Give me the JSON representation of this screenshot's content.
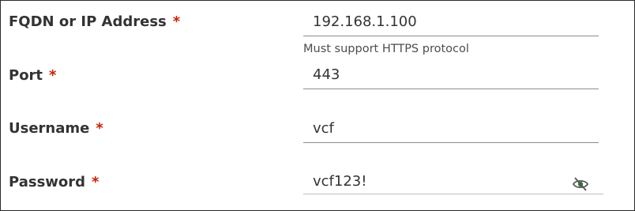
{
  "form": {
    "required_marker": "*",
    "fields": [
      {
        "label": "FQDN or IP Address",
        "value": "192.168.1.100",
        "hint": "Must support HTTPS protocol"
      },
      {
        "label": "Port",
        "value": "443"
      },
      {
        "label": "Username",
        "value": "vcf"
      },
      {
        "label": "Password",
        "value": "vcf123!"
      }
    ]
  },
  "icons": {
    "password_toggle": "eye-slash-icon"
  },
  "colors": {
    "required": "#c92100",
    "text": "#333333",
    "underline": "#8c8c8c",
    "eye_icon": "#2e7d32"
  }
}
